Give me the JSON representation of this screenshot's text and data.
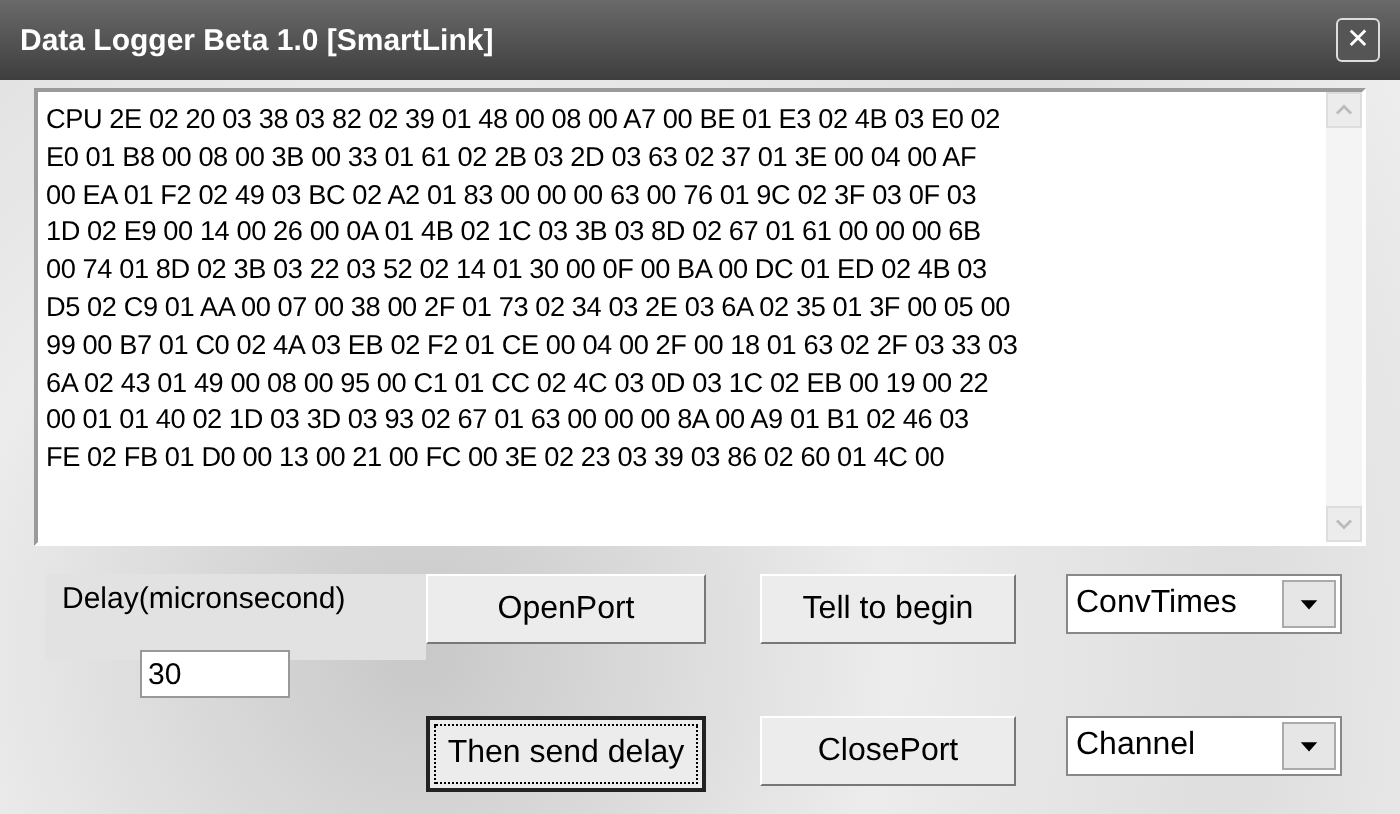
{
  "window": {
    "title": "Data Logger Beta 1.0 [SmartLink]",
    "close_button": "✕"
  },
  "log": {
    "lines": [
      "CPU 2E 02 20 03 38 03 82 02 39 01 48 00 08 00 A7 00 BE 01 E3 02 4B 03 E0 02",
      "E0 01 B8 00 08 00 3B 00 33 01 61 02 2B 03 2D 03 63 02 37 01 3E 00 04 00 AF",
      "00 EA 01 F2 02 49 03 BC 02 A2 01 83 00 00 00 63 00 76 01 9C 02 3F 03 0F 03",
      "1D 02 E9 00 14 00 26 00 0A 01 4B 02 1C 03 3B 03 8D 02 67 01 61 00 00 00 6B",
      "00 74 01 8D 02 3B 03 22 03 52 02 14 01 30 00 0F 00 BA 00 DC 01 ED 02 4B 03",
      "D5 02 C9 01 AA 00 07 00 38 00 2F 01 73 02 34 03 2E 03 6A 02 35 01 3F 00 05 00",
      "99 00 B7 01 C0 02 4A 03 EB 02 F2 01 CE 00 04 00 2F 00 18 01 63 02 2F 03 33 03",
      "6A 02 43 01 49 00 08 00 95 00 C1 01 CC 02 4C 03 0D 03 1C 02 EB 00 19 00 22",
      "00 01 01 40 02 1D 03 3D 03 93 02 67 01 63 00 00 00 8A 00 A9 01 B1 02 46 03",
      "FE 02 FB 01 D0 00 13 00 21 00 FC 00 3E 02 23 03 39 03 86 02 60 01 4C 00"
    ]
  },
  "delay": {
    "label": "Delay(micronsecond)",
    "value": "30"
  },
  "buttons": [
    {
      "label": "OpenPort",
      "focused": false
    },
    {
      "label": "Tell to begin",
      "focused": false
    },
    {
      "label": "Then send delay",
      "focused": true
    },
    {
      "label": "ClosePort",
      "focused": false
    }
  ],
  "combos": [
    {
      "value": "ConvTimes"
    },
    {
      "value": "Channel"
    }
  ]
}
